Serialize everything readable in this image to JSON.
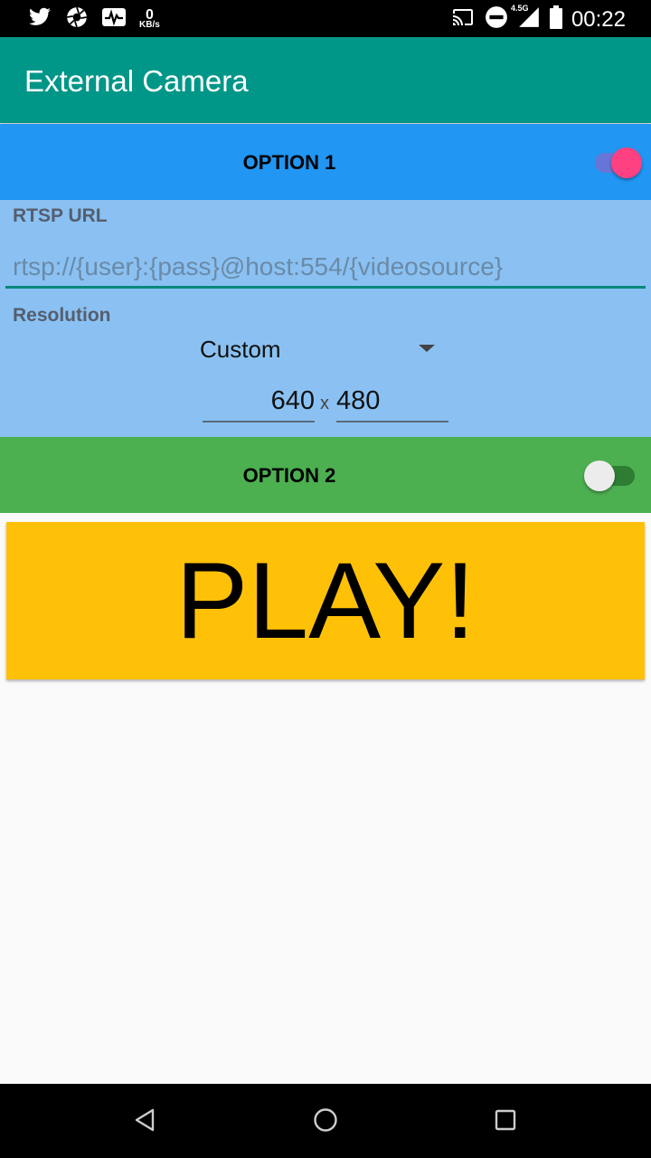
{
  "status_bar": {
    "left_icons": [
      "twitter-icon",
      "aperture-icon",
      "activity-monitor-icon"
    ],
    "net_speed_value": "0",
    "net_speed_unit": "KB/s",
    "right_icons": [
      "cast-icon",
      "do-not-disturb-icon",
      "signal-icon",
      "battery-icon"
    ],
    "network_type": "4.5G",
    "time": "00:22"
  },
  "app_bar": {
    "title": "External Camera"
  },
  "option1": {
    "label": "OPTION 1",
    "enabled": true,
    "rtsp_label": "RTSP URL",
    "rtsp_placeholder": "rtsp://{user}:{pass}@host:554/{videosource}",
    "rtsp_value": "",
    "resolution_label": "Resolution",
    "resolution_selected": "Custom",
    "width": "640",
    "separator": "x",
    "height": "480"
  },
  "option2": {
    "label": "OPTION 2",
    "enabled": false
  },
  "play_button": {
    "label": "PLAY!"
  },
  "colors": {
    "app_bar": "#009688",
    "option1_header": "#2196f3",
    "option1_panel": "#8ac1f2",
    "option2_header": "#4caf50",
    "play_button": "#ffc107",
    "switch_on_thumb": "#ff4081"
  },
  "nav_bar": {
    "icons": [
      "back-icon",
      "home-icon",
      "recents-icon"
    ]
  }
}
